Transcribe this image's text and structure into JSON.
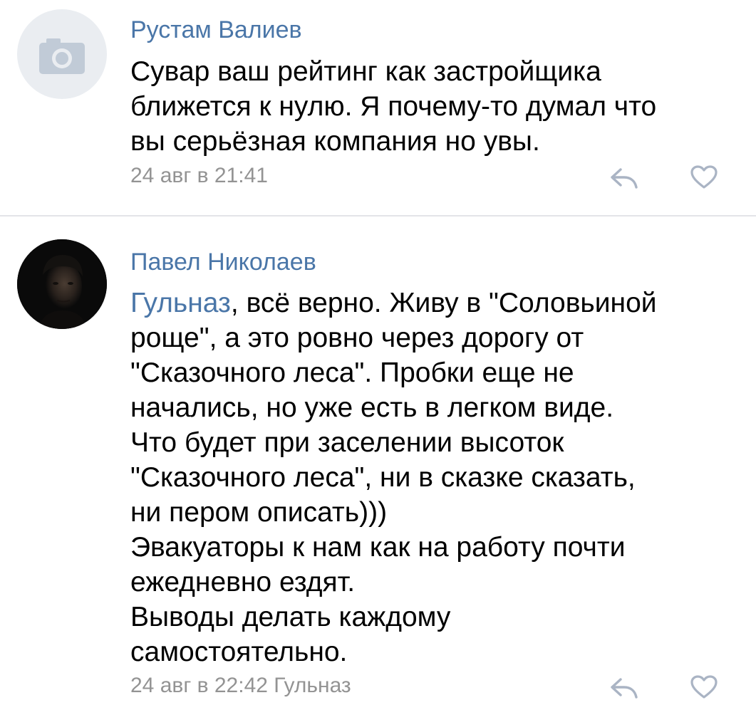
{
  "comments": [
    {
      "author": "Рустам Валиев",
      "avatar": "camera-placeholder-icon",
      "text": "Сувар ваш рейтинг как застройщика\nближется к нулю. Я почему-то думал что\nвы серьёзная компания но увы.",
      "meta": "24 авг в 21:41",
      "reply_icon": "reply-icon",
      "like_icon": "heart-icon"
    },
    {
      "author": "Павел Николаев",
      "avatar": "user-photo",
      "mention": "Гульназ",
      "text": ", всё верно. Живу в \"Соловьиной\nроще\", а это ровно через дорогу от\n\"Сказочного леса\". Пробки еще не\nначались, но уже есть в легком виде.\nЧто будет при заселении высоток\n\"Сказочного леса\", ни в сказке сказать,\nни пером описать)))\nЭвакуаторы к нам как на работу почти\nежедневно ездят.\nВыводы делать каждому\nсамостоятельно.",
      "meta": "24 авг в 22:42 Гульназ",
      "reply_icon": "reply-icon",
      "like_icon": "heart-icon"
    }
  ],
  "colors": {
    "link": "#4a76a8",
    "meta": "#939393",
    "icon": "#aab4c4",
    "divider": "#e3e4e8",
    "placeholder_bg": "#eaedf1",
    "placeholder_icon": "#c1cbd7"
  }
}
